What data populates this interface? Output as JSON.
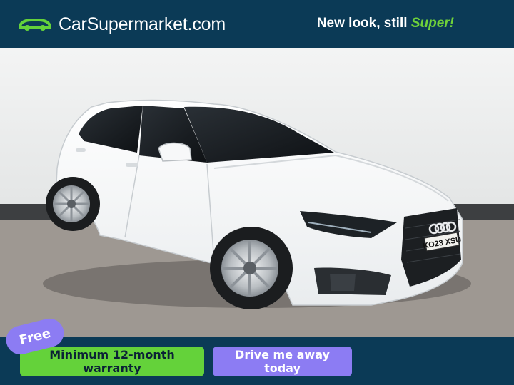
{
  "header": {
    "brand_name": "CarSupermarket.com",
    "tagline_main": "New look, still ",
    "tagline_accent": "Super!"
  },
  "listing_photo": {
    "number_plate": "KO23 XSU"
  },
  "badges": {
    "free_label": "Free"
  },
  "footer": {
    "warranty_label": "Minimum 12-month warranty",
    "drive_away_label": "Drive me away today"
  },
  "colors": {
    "navy": "#0b3a56",
    "green": "#64d23a",
    "purple": "#8c7cf3"
  }
}
